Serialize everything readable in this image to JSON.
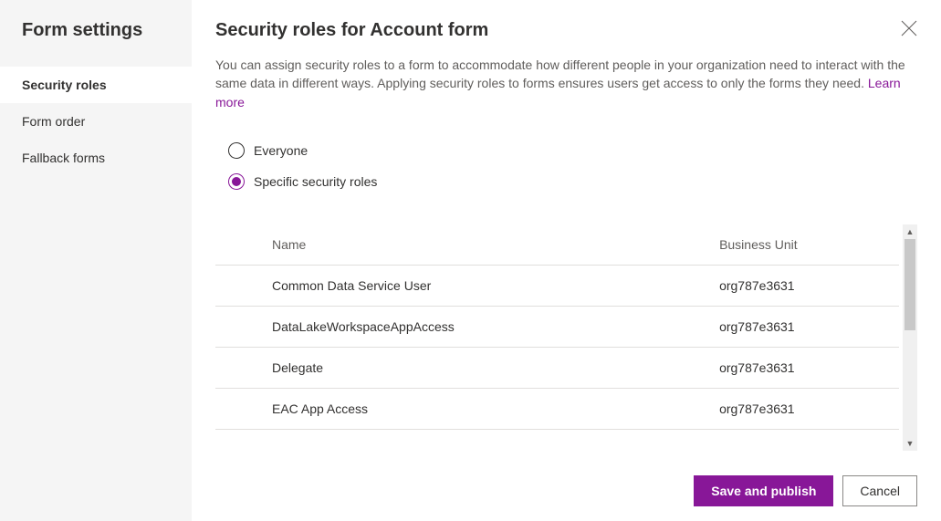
{
  "sidebar": {
    "title": "Form settings",
    "items": [
      {
        "label": "Security roles",
        "active": true
      },
      {
        "label": "Form order",
        "active": false
      },
      {
        "label": "Fallback forms",
        "active": false
      }
    ]
  },
  "page": {
    "title": "Security roles for Account form",
    "description": "You can assign security roles to a form to accommodate how different people in your organization need to interact with the same data in different ways. Applying security roles to forms ensures users get access to only the forms they need. ",
    "learn_more": "Learn more"
  },
  "radio": {
    "everyone": "Everyone",
    "specific": "Specific security roles",
    "selected": "specific"
  },
  "table": {
    "headers": {
      "name": "Name",
      "business_unit": "Business Unit"
    },
    "rows": [
      {
        "name": "Common Data Service User",
        "business_unit": "org787e3631"
      },
      {
        "name": "DataLakeWorkspaceAppAccess",
        "business_unit": "org787e3631"
      },
      {
        "name": "Delegate",
        "business_unit": "org787e3631"
      },
      {
        "name": "EAC App Access",
        "business_unit": "org787e3631"
      }
    ]
  },
  "footer": {
    "save_publish": "Save and publish",
    "cancel": "Cancel"
  }
}
